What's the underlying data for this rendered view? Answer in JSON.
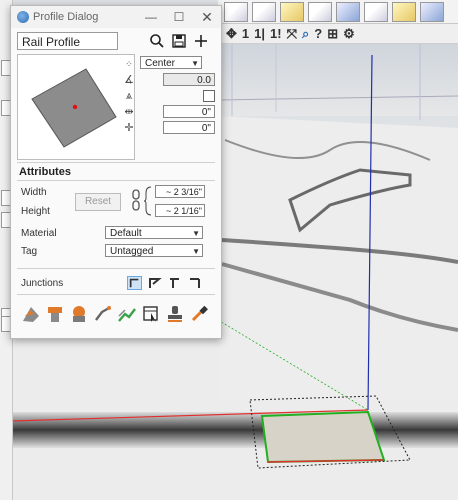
{
  "dialog": {
    "title": "Profile Dialog",
    "minimize_icon": "minimize-icon",
    "maximize_icon": "maximize-icon",
    "close_icon": "close-icon",
    "profile_name": "Rail Profile",
    "anchor": "Center",
    "rotation": "0.0",
    "offset_x": "0\"",
    "offset_y": "0\"",
    "attributes_heading": "Attributes",
    "width_label": "Width",
    "height_label": "Height",
    "reset_label": "Reset",
    "width_value": "~ 2 3/16\"",
    "height_value": "~ 2 1/16\"",
    "material_label": "Material",
    "material_value": "Default",
    "tag_label": "Tag",
    "tag_value": "Untagged",
    "junctions_label": "Junctions"
  },
  "toolbar": {
    "icons": [
      "move-arrows-icon",
      "number-one-icon",
      "number-one-bar-icon",
      "number-one-exclaim-icon",
      "transform-icon",
      "search-icon",
      "help-icon",
      "dimension-icon",
      "gear-icon"
    ]
  },
  "colors": {
    "axis_red": "#e03030",
    "axis_green": "#20b020",
    "axis_blue": "#1f2fb0",
    "accent": "#2b6cb5"
  }
}
